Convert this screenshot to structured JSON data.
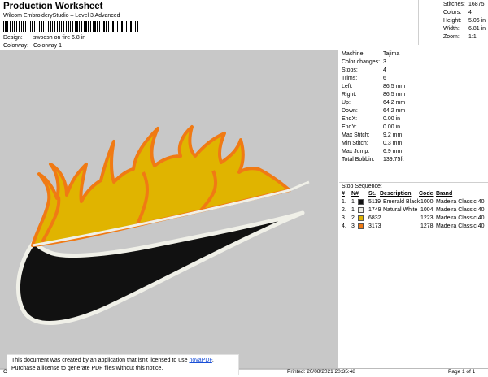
{
  "header": {
    "title": "Production Worksheet",
    "subtitle": "Wilcom EmbroideryStudio – Level 3 Advanced",
    "design_key": "Design:",
    "design_val": "swoosh on fire 6.8 in",
    "colorway_key": "Colorway:",
    "colorway_val": "Colorway 1"
  },
  "stats_top": [
    {
      "k": "Stitches:",
      "v": "16875"
    },
    {
      "k": "Colors:",
      "v": "4"
    },
    {
      "k": "Height:",
      "v": "5.06 in"
    },
    {
      "k": "Width:",
      "v": "6.81 in"
    },
    {
      "k": "Zoom:",
      "v": "1:1"
    }
  ],
  "info": [
    {
      "k": "Machine:",
      "v": "Tajima"
    },
    {
      "k": "Color changes:",
      "v": "3"
    },
    {
      "k": "Stops:",
      "v": "4"
    },
    {
      "k": "Trims:",
      "v": "6"
    },
    {
      "k": "Left:",
      "v": "86.5 mm"
    },
    {
      "k": "Right:",
      "v": "86.5 mm"
    },
    {
      "k": "Up:",
      "v": "64.2 mm"
    },
    {
      "k": "Down:",
      "v": "64.2 mm"
    },
    {
      "k": "EndX:",
      "v": "0.00 in"
    },
    {
      "k": "EndY:",
      "v": "0.00 in"
    },
    {
      "k": "Max Stitch:",
      "v": "9.2 mm"
    },
    {
      "k": "Min Stitch:",
      "v": "0.3 mm"
    },
    {
      "k": "Max Jump:",
      "v": "6.9 mm"
    },
    {
      "k": "Total Bobbin:",
      "v": "139.75ft"
    }
  ],
  "stop_sequence": {
    "title": "Stop Sequence:",
    "headers": [
      "#",
      "N#",
      "St.",
      "Description",
      "Code",
      "Brand"
    ],
    "rows": [
      {
        "num": "1.",
        "n": "1",
        "color": "#111111",
        "st": "5119",
        "desc": "Emerald Black",
        "code": "1000",
        "brand": "Madeira Classic 40"
      },
      {
        "num": "2.",
        "n": "1",
        "color": "#f0f0e8",
        "st": "1749",
        "desc": "Natural White",
        "code": "1004",
        "brand": "Madeira Classic 40"
      },
      {
        "num": "3.",
        "n": "2",
        "color": "#e0b400",
        "st": "6832",
        "desc": "",
        "code": "1223",
        "brand": "Madeira Classic 40"
      },
      {
        "num": "4.",
        "n": "3",
        "color": "#f07a14",
        "st": "3173",
        "desc": "",
        "code": "1278",
        "brand": "Madeira Classic 40"
      }
    ]
  },
  "footer": {
    "left": "Cr",
    "printed": "Printed: 20/08/2021 20:35:48",
    "page": "Page 1 of 1"
  },
  "notice": {
    "line1_pre": "This document was created by an application that isn't licensed to use ",
    "link": "novaPDF",
    "line1_post": ".",
    "line2": "Purchase a license to generate PDF files without this notice."
  },
  "colors": {
    "canvas": "#c8c8c8",
    "flame_outline": "#f07a14",
    "flame_fill": "#e0b400",
    "swoosh_fill": "#111111",
    "swoosh_outline": "#f0f0e8"
  }
}
